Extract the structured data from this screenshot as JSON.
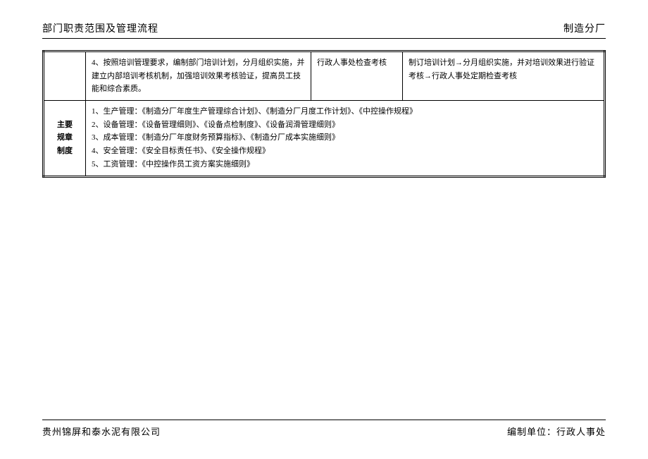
{
  "header": {
    "left": "部门职责范围及管理流程",
    "right": "制造分厂"
  },
  "row1": {
    "cell_empty": "",
    "cell_a": "4、按照培训管理要求，编制部门培训计划，分月组织实施，并建立内部培训考核机制，加强培训效果考核验证，提高员工技能和综合素质。",
    "cell_b": "行政人事处检查考核",
    "cell_c": "制订培训计划→分月组织实施，并对培训效果进行验证考核→行政人事处定期检查考核"
  },
  "row2": {
    "label": "主要\n规章\n制度",
    "lines": [
      "1、生产管理：《制造分厂年度生产管理综合计划》、《制造分厂月度工作计划》、《中控操作规程》",
      "2、设备管理：《设备管理细则》、《设备点检制度》、《设备润滑管理细则》",
      "3、成本管理：《制造分厂年度财务预算指标》、《制造分厂成本实施细则》",
      "4、安全管理：《安全目标责任书》、《安全操作规程》",
      "5、工资管理：《中控操作员工资方案实施细则》"
    ]
  },
  "footer": {
    "left": "贵州锦屏和泰水泥有限公司",
    "right": "编制单位：行政人事处"
  }
}
